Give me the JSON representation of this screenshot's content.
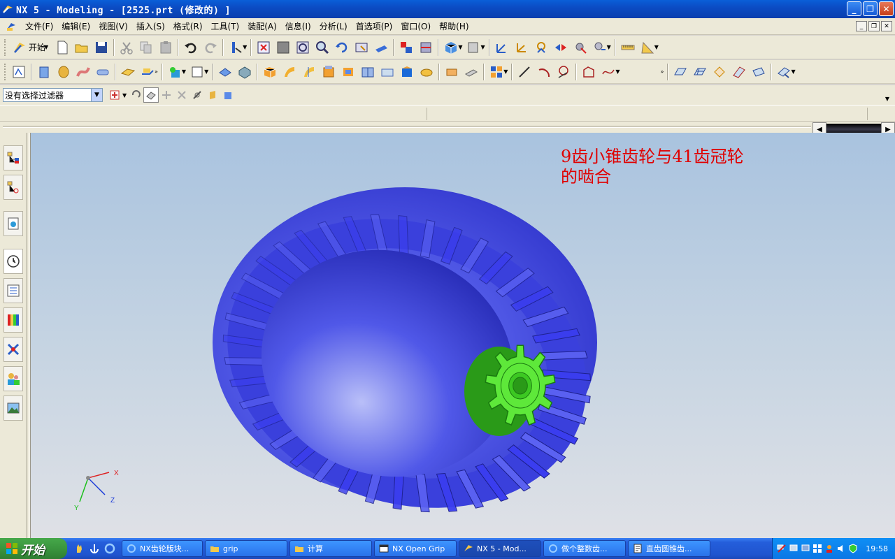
{
  "window": {
    "title": "NX 5 - Modeling - [2525.prt  (修改的) ]"
  },
  "menubar": {
    "items": [
      "文件(F)",
      "编辑(E)",
      "视图(V)",
      "插入(S)",
      "格式(R)",
      "工具(T)",
      "装配(A)",
      "信息(I)",
      "分析(L)",
      "首选项(P)",
      "窗口(O)",
      "帮助(H)"
    ]
  },
  "toolbar": {
    "start_label": "开始"
  },
  "selection": {
    "filter_value": "没有选择过滤器"
  },
  "graphics": {
    "annotation_line1": "9齿小锥齿轮与41齿冠轮",
    "annotation_line2": "的啮合",
    "triad": {
      "x": "X",
      "y": "Y",
      "z": "Z"
    },
    "crown_color": "#3a3df0",
    "pinion_color": "#5ee83a"
  },
  "taskbar": {
    "start_label": "开始",
    "tasks": [
      {
        "label": "NX齿轮版块...",
        "icon": "ie-icon"
      },
      {
        "label": "grip",
        "icon": "folder-icon"
      },
      {
        "label": "计算",
        "icon": "folder-icon"
      },
      {
        "label": "NX Open Grip",
        "icon": "app-icon"
      },
      {
        "label": "NX 5 - Mod...",
        "icon": "nx-icon"
      },
      {
        "label": "做个整数齿...",
        "icon": "ie-icon"
      },
      {
        "label": "直齿圆锥齿...",
        "icon": "doc-icon"
      }
    ],
    "clock": "19:58"
  }
}
